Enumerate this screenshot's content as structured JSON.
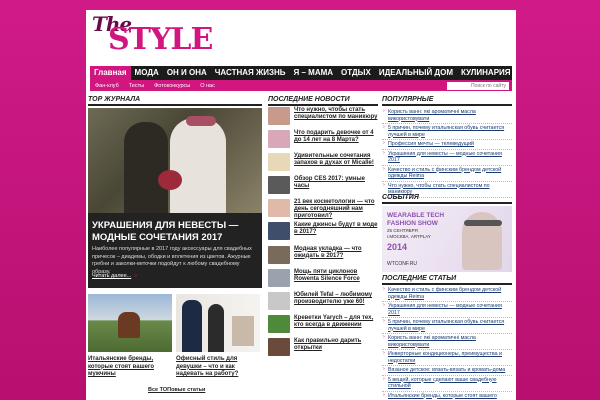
{
  "logo": {
    "the": "The",
    "style": "STYLE"
  },
  "nav": {
    "items": [
      "Главная",
      "МОДА",
      "ОН И ОНА",
      "ЧАСТНАЯ ЖИЗНЬ",
      "Я – МАМА",
      "ОТДЫХ",
      "ИДЕАЛЬНЫЙ ДОМ",
      "КУЛИНАРИЯ"
    ],
    "rss_icon": "rss-icon"
  },
  "subnav": {
    "items": [
      "Фан-клуб",
      "Тесты",
      "Фотоконкурсы",
      "О нас"
    ],
    "search_placeholder": "Поиск по сайту"
  },
  "sections": {
    "top": "ТОР ЖУРНАЛА",
    "news": "ПОСЛЕДНИЕ НОВОСТИ",
    "popular": "ПОПУЛЯРНЫЕ",
    "events": "СОБЫТИЯ",
    "latest": "ПОСЛЕДНИЕ СТАТЬИ"
  },
  "feature": {
    "headline": "УКРАШЕНИЯ ДЛЯ НЕВЕСТЫ — МОДНЫЕ СОЧЕТАНИЯ 2017",
    "excerpt": "Наиболее популярные в 2017 году аксессуары для свадебных причесок – диадемы, ободки и вплетения из цветов. Ажурные гребни и заколки-веточки подойдут к любому свадебному образу,",
    "more": "Читать далее...",
    "more_arrow": "»"
  },
  "bottom_thumbs": [
    {
      "caption": "Итальянские бренды, которые стоят вашего мужчины"
    },
    {
      "caption": "Офисный стиль для девушки – что и как надевать на работу?"
    }
  ],
  "all_top": "Все ТОПовые статьи",
  "news": [
    {
      "title": "Что нужно, чтобы стать специалистом по маникюру",
      "color": "#c79a8c"
    },
    {
      "title": "Что подарить девочке от 4 до 14 лет на 8 Марта?",
      "color": "#d9a8b8"
    },
    {
      "title": "Удивительные сочетания запахов в духах от Micalle!",
      "color": "#e7d8b8"
    },
    {
      "title": "Обзор CES 2017: умные часы",
      "color": "#5a5a5a"
    },
    {
      "title": "21 век косметологии — что день сегодняшний нам приготовил?",
      "color": "#e0b9a8"
    },
    {
      "title": "Какие джинсы будут в моде в 2017?",
      "color": "#3f4e6b"
    },
    {
      "title": "Модная укладка — что ожидать в 2017?",
      "color": "#7a6a5c"
    },
    {
      "title": "Мощь пяти циклонов Rowenta Silence Force",
      "color": "#9aa3ad"
    },
    {
      "title": "Юбилей Tefal – любимому производителю уже 60!",
      "color": "#c8c8c8"
    },
    {
      "title": "Креветки Yarych – для тех, кто всегда в движении",
      "color": "#4e8a3a"
    },
    {
      "title": "Как правильно дарить открытки",
      "color": "#6a4a3a"
    }
  ],
  "popular": [
    "Користь ванн: які ароматичні масла використовувати",
    "5 причин, почему итальянская обувь считается лучшей в мире",
    "Профессия мечты — телеведущий",
    "Украшения для невесты — модные сочетания 2017",
    "Качество и стиль с финским брендом детской одежды Reima",
    "Что нужно, чтобы стать специалистом по маникюру"
  ],
  "event": {
    "line1": "WEARABLE TECH",
    "line2": "FASHION SHOW",
    "line3": "25 СЕНТЯБРЯ",
    "line4": "г.МОСКВА, ARTPLAY",
    "year": "2014",
    "site": "WTCONF.RU"
  },
  "latest": [
    "Качество и стиль с финским брендом детской одежды Reima",
    "Украшения для невесты — модные сочетания 2017",
    "5 причин, почему итальянская обувь считается лучшей в мире",
    "Користь ванн: які ароматичні масла використовувати",
    "Инверторные кондиционеры, преимущества и недостатки",
    "Вязаное детское: вязать-вязать и кровать-дома",
    "5 вещей, которые сделают ваше свадебную стильной",
    "Итальянские бренды, которые стоят вашего мужчины"
  ]
}
